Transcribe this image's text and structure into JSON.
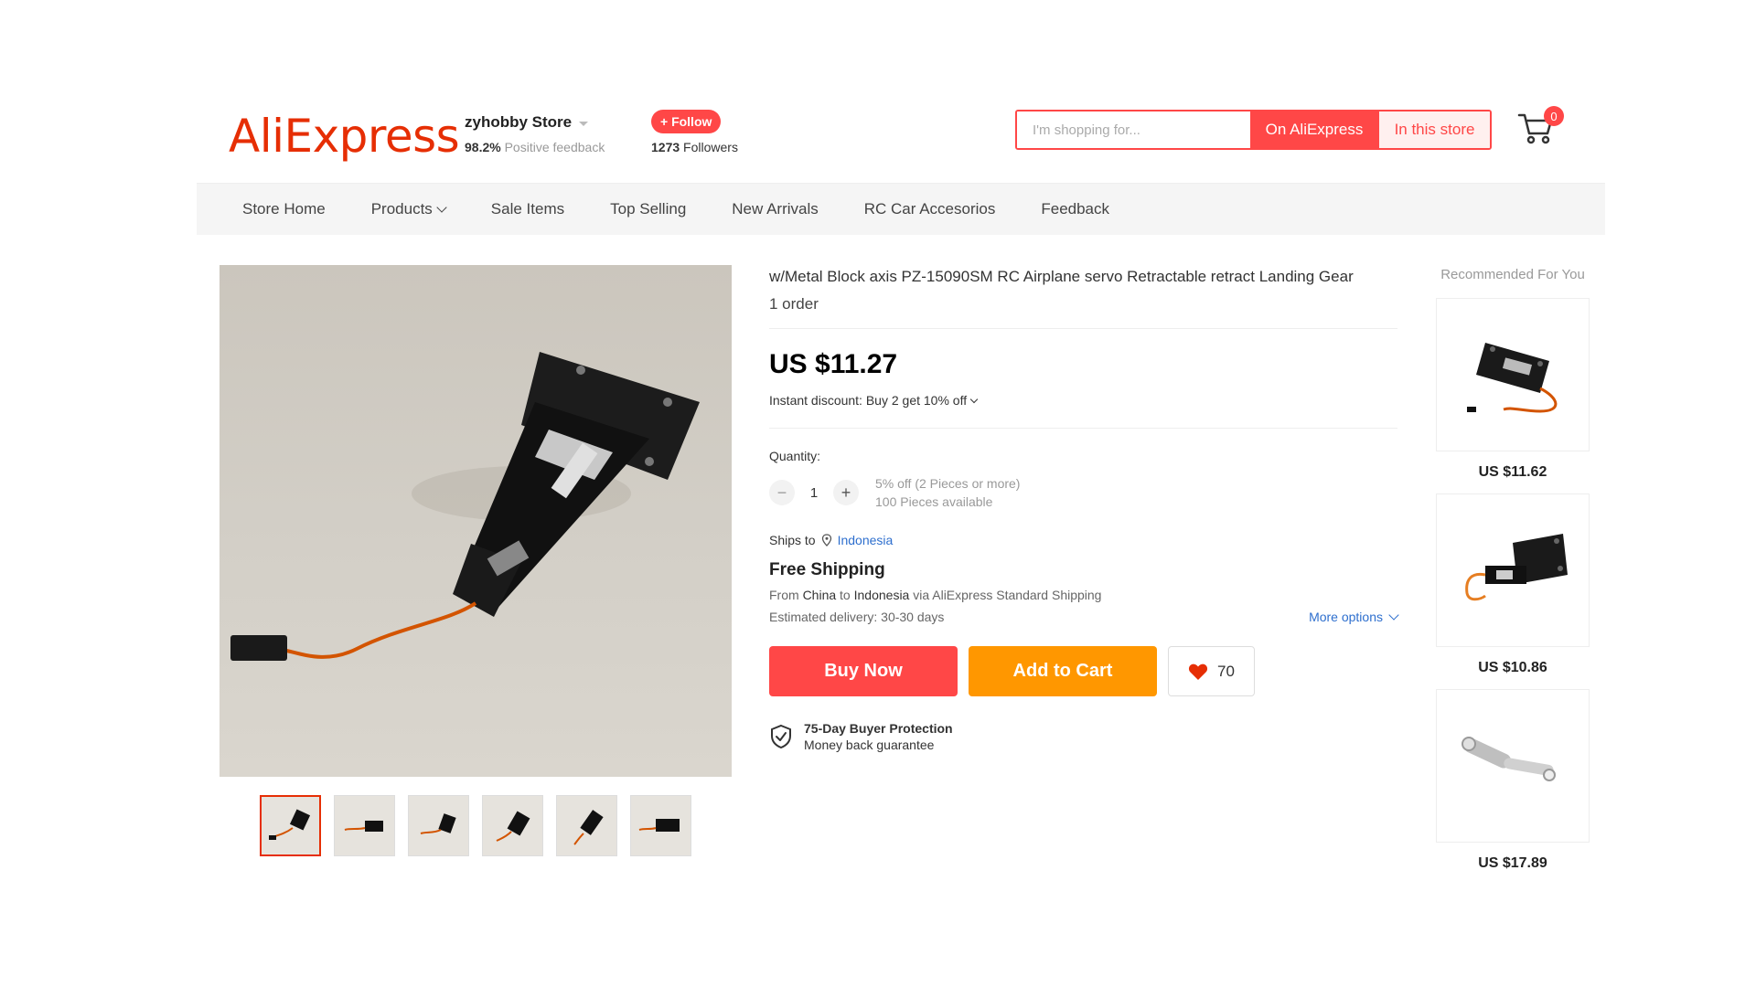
{
  "header": {
    "logo": "AliExpress",
    "store_name": "zyhobby Store",
    "feedback_percent": "98.2%",
    "feedback_label": "Positive feedback",
    "follow_label": "+ Follow",
    "followers_count": "1273",
    "followers_label": "Followers",
    "search_placeholder": "I'm shopping for...",
    "search_on_site": "On AliExpress",
    "search_in_store": "In this store",
    "cart_count": "0"
  },
  "nav": {
    "items": [
      "Store Home",
      "Products",
      "Sale Items",
      "Top Selling",
      "New Arrivals",
      "RC Car Accesorios",
      "Feedback"
    ]
  },
  "product": {
    "title": "w/Metal Block axis PZ-15090SM RC Airplane servo Retractable retract Landing Gear",
    "orders": "1 order",
    "price": "US $11.27",
    "discount": "Instant discount: Buy 2 get 10% off",
    "quantity_label": "Quantity:",
    "quantity_value": "1",
    "qty_discount_note": "5% off (2 Pieces or more)",
    "qty_available": "100 Pieces available",
    "ships_to_label": "Ships to",
    "ships_to_country": "Indonesia",
    "free_shipping": "Free Shipping",
    "ship_from_prefix": "From",
    "ship_from_country": "China",
    "ship_to_word": "to",
    "ship_to_country2": "Indonesia",
    "ship_via": "via AliExpress Standard Shipping",
    "estimated_delivery": "Estimated delivery: 30-30 days",
    "more_options": "More options",
    "buy_now": "Buy Now",
    "add_to_cart": "Add to Cart",
    "wish_count": "70",
    "protection_title": "75-Day Buyer Protection",
    "protection_sub": "Money back guarantee"
  },
  "recommended": {
    "title": "Recommended For You",
    "items": [
      {
        "price": "US $11.62"
      },
      {
        "price": "US $10.86"
      },
      {
        "price": "US $17.89"
      }
    ]
  },
  "colors": {
    "brand": "#e62e04",
    "primary": "#ff4747",
    "accent": "#ff9700",
    "link": "#2e6fce"
  },
  "icons": [
    "cart-icon",
    "caret-down-icon",
    "location-pin-icon",
    "heart-icon",
    "shield-check-icon",
    "minus-icon",
    "plus-icon",
    "chevron-down-icon"
  ]
}
